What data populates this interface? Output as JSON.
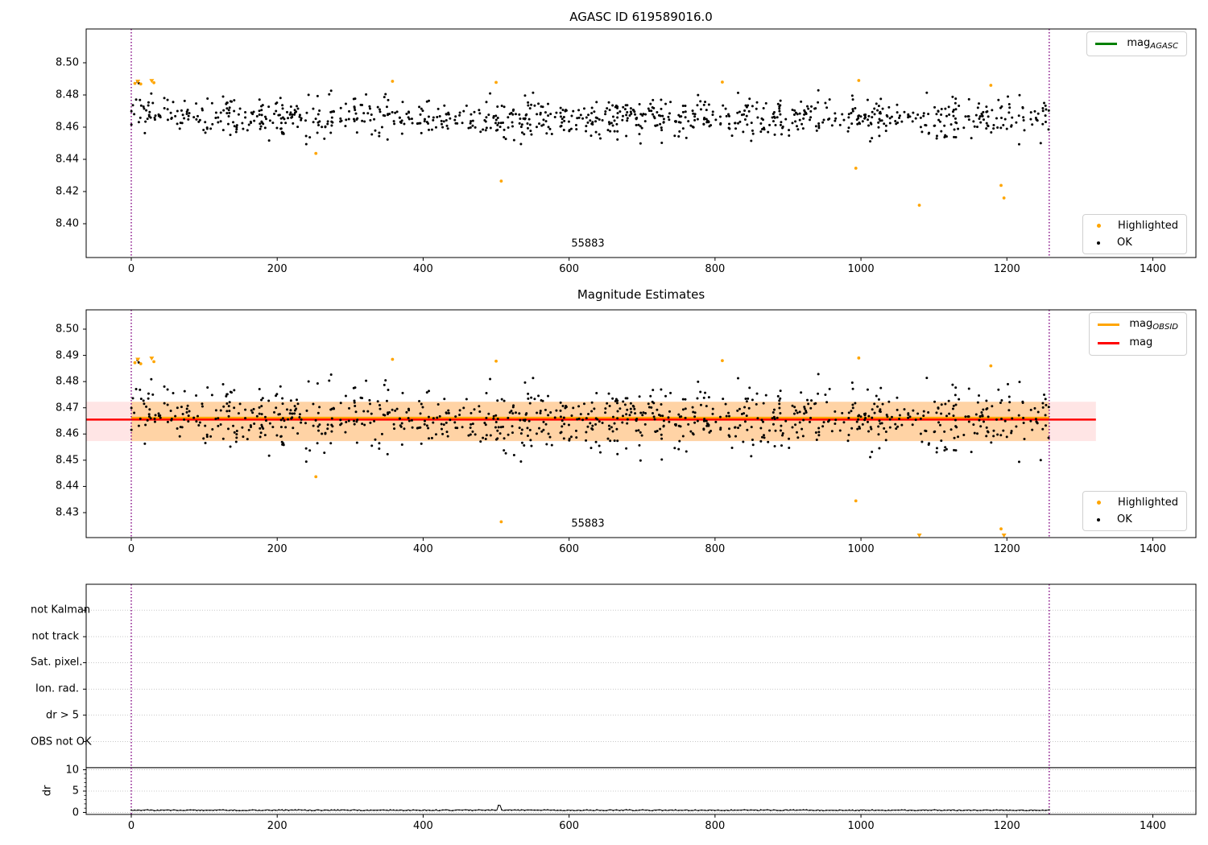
{
  "page": {
    "background": "#ffffff"
  },
  "colors": {
    "ok_points": "#000000",
    "highlighted_points": "#FFA500",
    "agasc_line": "#008000",
    "mag_line": "#FF0000",
    "obsid_line": "#FFA500",
    "mag_band": "rgba(255,0,0,0.10)",
    "obsid_band": "rgba(255,165,0,0.28)",
    "vline": "#800080",
    "grid": "#c8c8c8",
    "axis": "#000000"
  },
  "chart_data": [
    {
      "type": "scatter",
      "title": "AGASC ID 619589016.0",
      "xlim": [
        -62,
        1459
      ],
      "ylim": [
        8.379,
        8.521
      ],
      "xticks": [
        0,
        200,
        400,
        600,
        800,
        1000,
        1200,
        1400
      ],
      "yticks": [
        8.4,
        8.42,
        8.44,
        8.46,
        8.48,
        8.5
      ],
      "ytick_labels": [
        "8.40",
        "8.42",
        "8.44",
        "8.46",
        "8.48",
        "8.50"
      ],
      "vlines": {
        "x": [
          0,
          1258
        ]
      },
      "annotations": [
        {
          "text": "55883",
          "x": 626,
          "y": 8.387
        }
      ],
      "legend_lines": [
        {
          "label": "mag",
          "sub": "AGASC",
          "color": "#008000"
        }
      ],
      "legend_points": [
        {
          "label": "Highlighted",
          "color": "#FFA500"
        },
        {
          "label": "OK",
          "color": "#000000"
        }
      ],
      "ok_series": {
        "marker": "dot",
        "color": "#000000",
        "n": 950,
        "x_range": [
          0,
          1258
        ],
        "mean_mag": 8.466,
        "std_mag": 0.0058,
        "start_elevation": 0.007,
        "min_mag": 8.4455,
        "max_mag": 8.4885,
        "seed": 20240613
      },
      "highlighted": {
        "color": "#FFA500",
        "points": [
          [
            5,
            8.4872
          ],
          [
            9,
            8.4885,
            "v"
          ],
          [
            13,
            8.4868
          ],
          [
            28,
            8.4889,
            "v"
          ],
          [
            31,
            8.4876
          ],
          [
            253,
            8.4437
          ],
          [
            358,
            8.4885
          ],
          [
            500,
            8.4878
          ],
          [
            507,
            8.4265
          ],
          [
            810,
            8.488
          ],
          [
            993,
            8.4345
          ],
          [
            997,
            8.489
          ],
          [
            1080,
            8.4115
          ],
          [
            1178,
            8.486
          ],
          [
            1192,
            8.4238
          ],
          [
            1196,
            8.416
          ]
        ]
      }
    },
    {
      "type": "scatter",
      "title": "Magnitude Estimates",
      "xlim": [
        -62,
        1459
      ],
      "ylim": [
        8.4205,
        8.5074
      ],
      "xticks": [
        0,
        200,
        400,
        600,
        800,
        1000,
        1200,
        1400
      ],
      "yticks": [
        8.43,
        8.44,
        8.45,
        8.46,
        8.47,
        8.48,
        8.49,
        8.5
      ],
      "ytick_labels": [
        "8.43",
        "8.44",
        "8.45",
        "8.46",
        "8.47",
        "8.48",
        "8.49",
        "8.50"
      ],
      "vlines": {
        "x": [
          0,
          1258
        ]
      },
      "annotations": [
        {
          "text": "55883",
          "x": 626,
          "y": 8.4245
        }
      ],
      "mag_line": {
        "value": 8.4655,
        "color": "#FF0000",
        "x_range": [
          -62,
          1322
        ]
      },
      "mag_band": {
        "lo": 8.4573,
        "hi": 8.4723,
        "x_range": [
          -62,
          1322
        ],
        "color": "rgba(255,0,0,0.10)"
      },
      "obsid_line": {
        "value": 8.4662,
        "color": "#FFA500",
        "x_range": [
          0,
          1258
        ]
      },
      "obsid_band": {
        "lo": 8.4573,
        "hi": 8.4723,
        "x_range": [
          0,
          1258
        ],
        "color": "rgba(255,165,0,0.28)"
      },
      "legend_lines": [
        {
          "label": "mag",
          "sub": "OBSID",
          "color": "#FFA500"
        },
        {
          "label": "mag",
          "sub": "",
          "color": "#FF0000"
        }
      ],
      "legend_points": [
        {
          "label": "Highlighted",
          "color": "#FFA500"
        },
        {
          "label": "OK",
          "color": "#000000"
        }
      ],
      "uses_series_of_chart": 0,
      "clipped_marker": "triangle-down"
    },
    {
      "type": "flags",
      "title": "",
      "ylabel": "dr",
      "xlim": [
        -62,
        1459
      ],
      "ylim": [
        -0.5,
        53.8
      ],
      "xticks": [
        0,
        200,
        400,
        600,
        800,
        1000,
        1200,
        1400
      ],
      "categories": [
        {
          "label": "not Kalman",
          "y": 47.4
        },
        {
          "label": "not track",
          "y": 41.2
        },
        {
          "label": "Sat. pixel.",
          "y": 35.1
        },
        {
          "label": "Ion. rad.",
          "y": 28.9
        },
        {
          "label": "dr > 5",
          "y": 22.8
        },
        {
          "label": "OBS not OK",
          "y": 16.6
        }
      ],
      "dr_ticks": [
        {
          "label": "0",
          "value": 0
        },
        {
          "label": "5",
          "value": 5
        },
        {
          "label": "10",
          "value": 10
        }
      ],
      "dr_minor_ticks": [
        1,
        2,
        3,
        4,
        6,
        7,
        8,
        9
      ],
      "separator_y": 10.5,
      "vlines": {
        "x": [
          0,
          1258
        ]
      },
      "dr_series": {
        "color": "#000000",
        "x_range": [
          0,
          1258
        ],
        "n": 560,
        "base": 0.4,
        "noise": 0.22,
        "spike": {
          "x": 505,
          "value": 1.65
        },
        "seed": 777
      }
    }
  ]
}
